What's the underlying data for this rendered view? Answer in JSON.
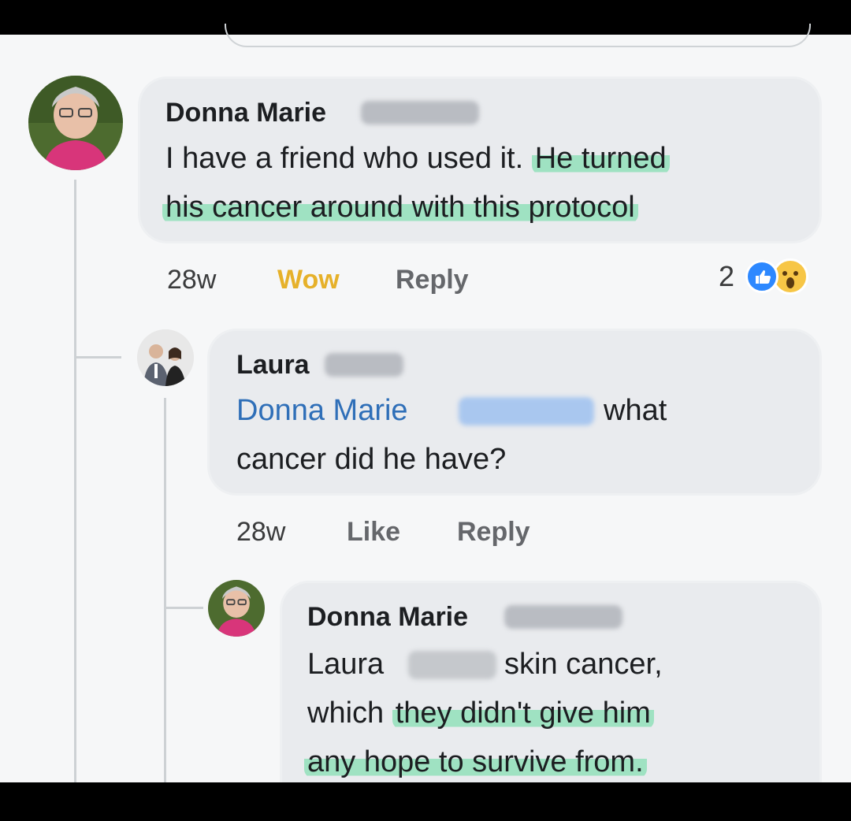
{
  "comments": [
    {
      "author": "Donna Marie",
      "text_plain": "I have a friend who used it. ",
      "text_highlight_1": "He turned",
      "text_highlight_2": "his cancer around with this protocol",
      "time": "28w",
      "reaction_action": "Wow",
      "reply_label": "Reply",
      "reaction_count": "2"
    },
    {
      "author": "Laura",
      "mention": "Donna Marie",
      "text_after_mention": "what",
      "text_line2": "cancer did he have?",
      "time": "28w",
      "like_label": "Like",
      "reply_label": "Reply"
    },
    {
      "author": "Donna Marie",
      "text_line1_a": "Laura",
      "text_line1_b": "skin cancer,",
      "text_line2_plain": "which ",
      "text_line2_highlight": "they didn't give him",
      "text_line3_highlight": "any hope to survive from."
    }
  ],
  "colors": {
    "bubble": "#e9ebee",
    "highlight": "#9fe2c2",
    "mention": "#2f6fb8",
    "wow": "#e6b12a",
    "like_reaction": "#2d88ff"
  }
}
